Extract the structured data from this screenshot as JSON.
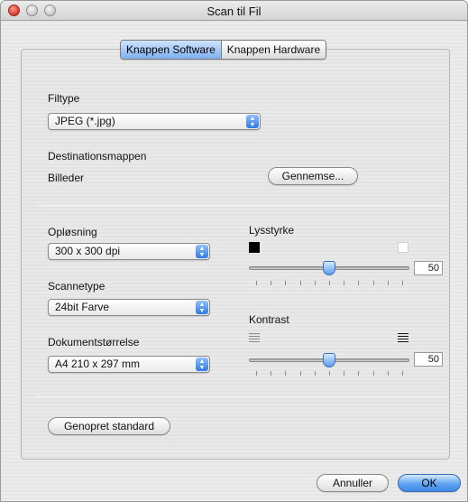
{
  "window": {
    "title": "Scan til Fil"
  },
  "tabs": [
    {
      "label": "Knappen Software",
      "active": true
    },
    {
      "label": "Knappen Hardware",
      "active": false
    }
  ],
  "file_type": {
    "label": "Filtype",
    "value": "JPEG (*.jpg)"
  },
  "destination": {
    "label": "Destinationsmappen",
    "folder": "Billeder",
    "browse_label": "Gennemse..."
  },
  "resolution": {
    "label": "Opløsning",
    "value": "300 x 300 dpi"
  },
  "scan_type": {
    "label": "Scannetype",
    "value": "24bit Farve"
  },
  "document_size": {
    "label": "Dokumentstørrelse",
    "value": "A4 210 x 297 mm"
  },
  "brightness": {
    "label": "Lysstyrke",
    "value": "50"
  },
  "contrast": {
    "label": "Kontrast",
    "value": "50"
  },
  "restore_defaults_label": "Genopret standard",
  "buttons": {
    "cancel": "Annuller",
    "ok": "OK"
  },
  "colors": {
    "accent": "#5ea3f3"
  }
}
